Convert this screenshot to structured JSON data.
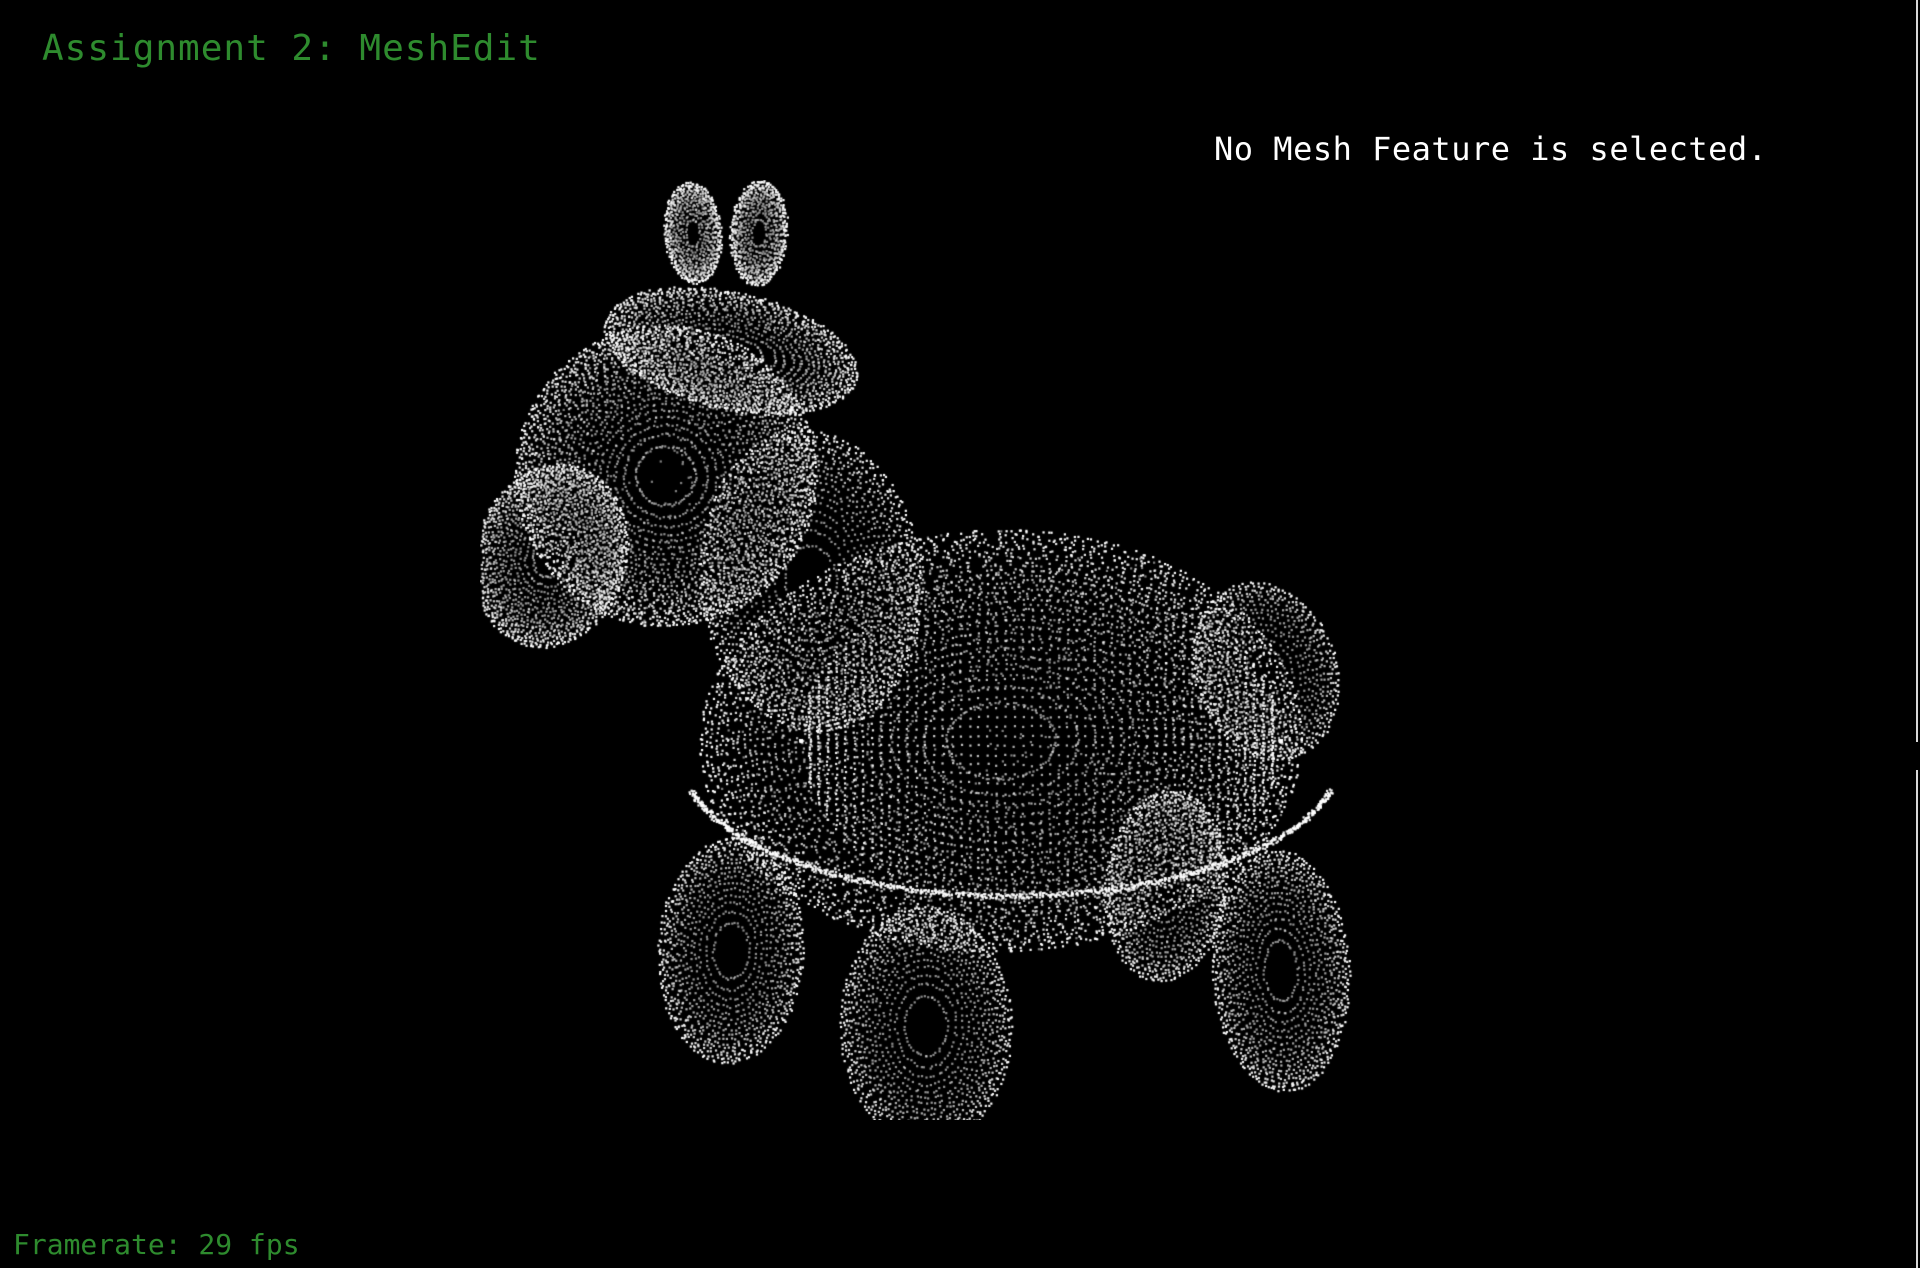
{
  "window": {
    "title": "Assignment 2: MeshEdit"
  },
  "overlay": {
    "selection_status": "No Mesh Feature is selected.",
    "framerate": "Framerate: 29 fps"
  },
  "colors": {
    "background": "#000000",
    "title_text": "#2e8b2e",
    "status_text": "#ffffff",
    "framerate_text": "#2e8b2e",
    "mesh_points": "#ffffff"
  },
  "scene": {
    "model": "cow-shaped point cloud",
    "render_mode": "points"
  }
}
